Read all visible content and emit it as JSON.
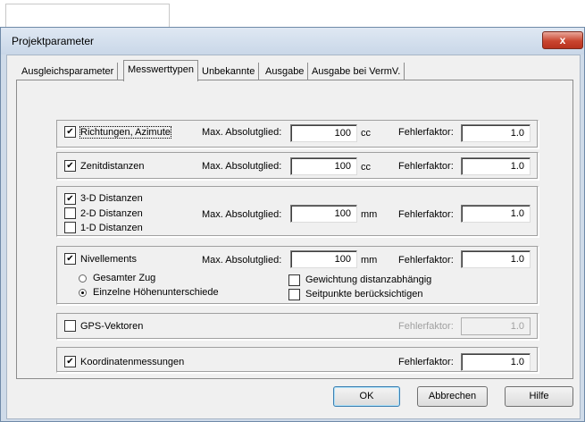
{
  "window": {
    "title": "Projektparameter",
    "close_glyph": "x"
  },
  "tabs": [
    "Ausgleichsparameter",
    "Messwerttypen",
    "Unbekannte",
    "Ausgabe",
    "Ausgabe bei VermV."
  ],
  "labels": {
    "max": "Max. Absolutglied:",
    "fehler": "Fehlerfaktor:"
  },
  "groups": {
    "richtungen": {
      "checkbox": "Richtungen, Azimute",
      "checked": true,
      "max_value": "100",
      "unit": "cc",
      "factor": "1.0"
    },
    "zenit": {
      "checkbox": "Zenitdistanzen",
      "checked": true,
      "max_value": "100",
      "unit": "cc",
      "factor": "1.0"
    },
    "distanzen": {
      "items": [
        {
          "label": "3-D Distanzen",
          "checked": true
        },
        {
          "label": "2-D Distanzen",
          "checked": false
        },
        {
          "label": "1-D Distanzen",
          "checked": false
        }
      ],
      "max_value": "100",
      "unit": "mm",
      "factor": "1.0"
    },
    "nivellements": {
      "checkbox": "Nivellements",
      "checked": true,
      "max_value": "100",
      "unit": "mm",
      "factor": "1.0",
      "radio1": "Gesamter Zug",
      "radio2": "Einzelne Höhenunterschiede",
      "radio_selected": "Einzelne Höhenunterschiede",
      "opt1": "Gewichtung distanzabhängig",
      "opt2": "Seitpunkte berücksichtigen"
    },
    "gps": {
      "checkbox": "GPS-Vektoren",
      "checked": false,
      "factor": "1.0"
    },
    "koordinaten": {
      "checkbox": "Koordinatenmessungen",
      "checked": true,
      "factor": "1.0"
    }
  },
  "buttons": {
    "ok": "OK",
    "cancel": "Abbrechen",
    "help": "Hilfe"
  }
}
